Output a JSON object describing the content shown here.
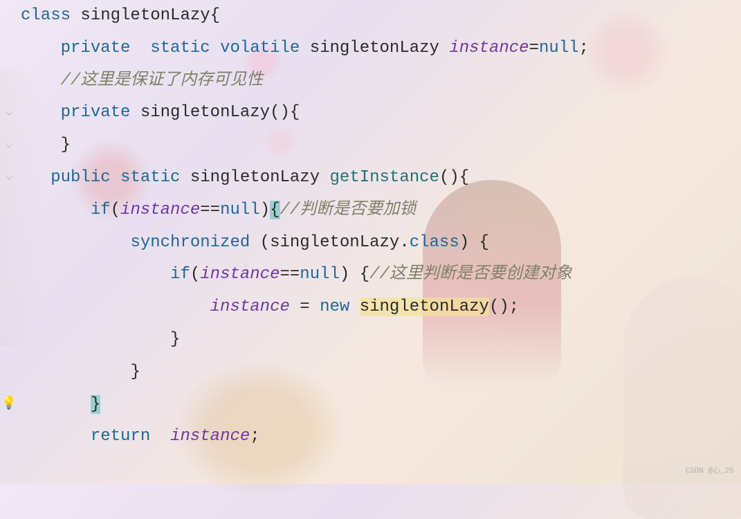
{
  "code": {
    "line1": {
      "kw_class": "class",
      "classname": "singletonLazy",
      "brace": "{"
    },
    "line2": {
      "kw_private": "private",
      "kw_static": "static",
      "kw_volatile": "volatile",
      "type": "singletonLazy",
      "var": "instance",
      "eq": "=",
      "null": "null",
      "semi": ";"
    },
    "line3": {
      "comment": "//这里是保证了内存可见性"
    },
    "line4": {
      "kw_private": "private",
      "ctor": "singletonLazy",
      "parens": "()",
      "brace": "{"
    },
    "line5": {
      "brace": "}"
    },
    "line6": {
      "kw_public": "public",
      "kw_static": "static",
      "type": "singletonLazy",
      "method": "getInstance",
      "parens": "()",
      "brace": "{"
    },
    "line7": {
      "kw_if": "if",
      "open": "(",
      "var": "instance",
      "op": "==",
      "null": "null",
      "close": ")",
      "brace": "{",
      "comment": "//判断是否要加锁"
    },
    "line8": {
      "kw_sync": "synchronized",
      "open": " (",
      "type": "singletonLazy",
      "dot": ".",
      "kw_class": "class",
      "close": ") ",
      "brace": "{"
    },
    "line9": {
      "kw_if": "if",
      "open": "(",
      "var": "instance",
      "op": "==",
      "null": "null",
      "close": ") ",
      "brace": "{",
      "comment": "//这里判断是否要创建对象"
    },
    "line10": {
      "var": "instance",
      "eq": " = ",
      "kw_new": "new",
      "ctor": "singletonLazy",
      "parens": "()",
      "semi": ";"
    },
    "line11": {
      "brace": "}"
    },
    "line12": {
      "brace": "}"
    },
    "line13": {
      "brace": "}"
    },
    "line14": {
      "kw_return": "return",
      "var": "instance",
      "semi": ";"
    }
  },
  "watermark": "CSDN @心_25"
}
